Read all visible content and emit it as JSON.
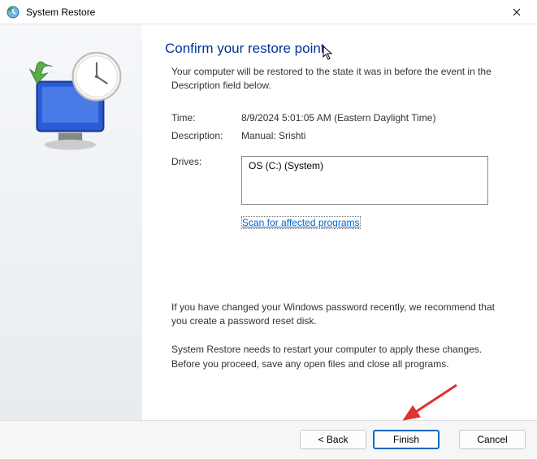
{
  "titlebar": {
    "title": "System Restore"
  },
  "main": {
    "heading": "Confirm your restore point",
    "subhead": "Your computer will be restored to the state it was in before the event in the Description field below.",
    "time_label": "Time:",
    "time_value": "8/9/2024 5:01:05 AM (Eastern Daylight Time)",
    "desc_label": "Description:",
    "desc_value": "Manual: Srishti",
    "drives_label": "Drives:",
    "drives_value": "OS (C:) (System)",
    "scan_link": "Scan for affected programs",
    "password_note": "If you have changed your Windows password recently, we recommend that you create a password reset disk.",
    "restart_note": "System Restore needs to restart your computer to apply these changes. Before you proceed, save any open files and close all programs."
  },
  "footer": {
    "back": "< Back",
    "finish": "Finish",
    "cancel": "Cancel"
  }
}
